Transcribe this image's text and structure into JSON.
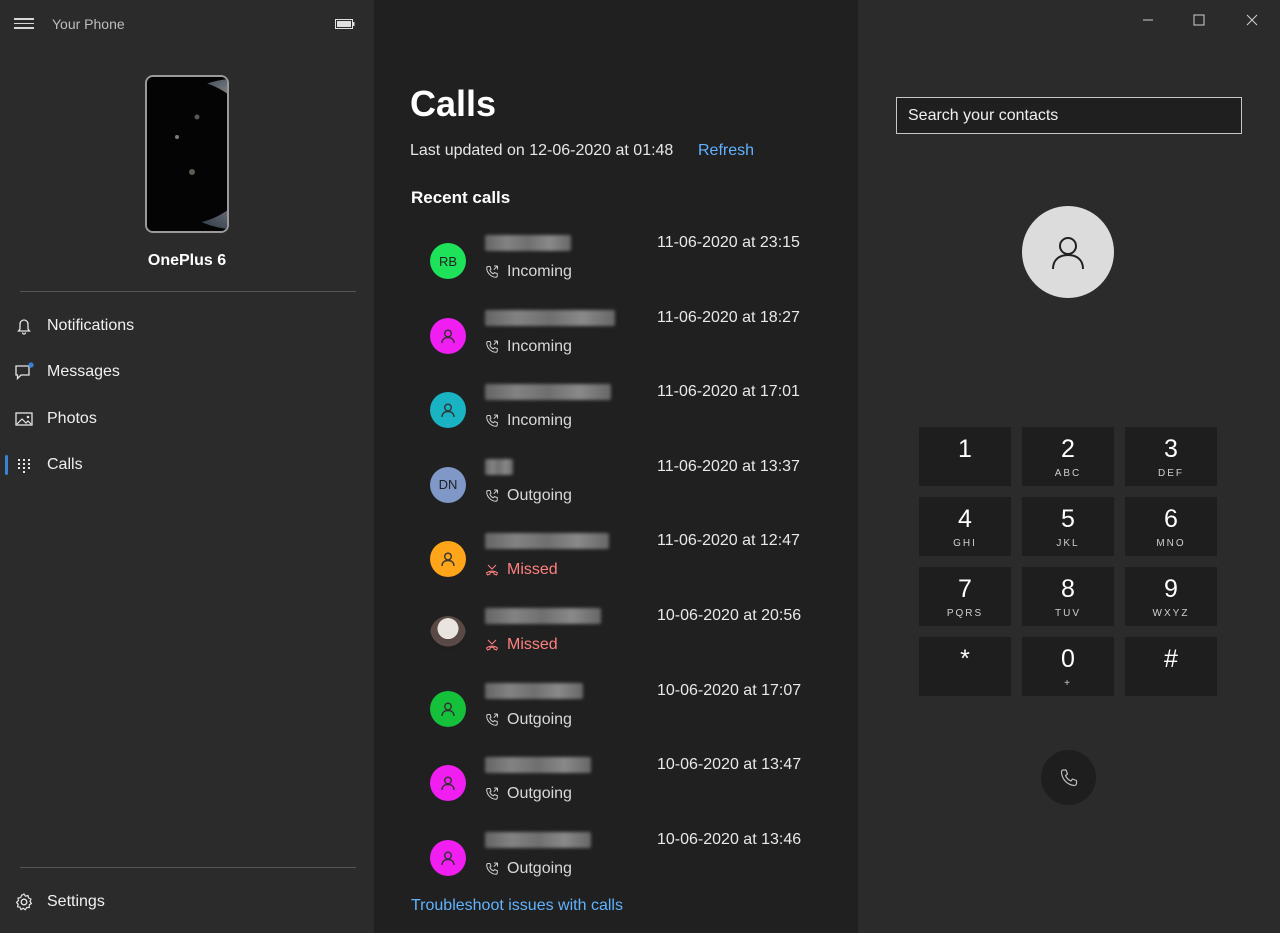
{
  "app": {
    "title": "Your Phone"
  },
  "phone": {
    "name": "OnePlus 6"
  },
  "sidebar": {
    "items": [
      {
        "label": "Notifications",
        "icon": "bell-icon"
      },
      {
        "label": "Messages",
        "icon": "message-icon"
      },
      {
        "label": "Photos",
        "icon": "photos-icon"
      },
      {
        "label": "Calls",
        "icon": "dialpad-icon",
        "active": true
      }
    ],
    "settings_label": "Settings"
  },
  "calls": {
    "title": "Calls",
    "last_updated": "Last updated on 12-06-2020 at 01:48",
    "refresh_label": "Refresh",
    "recent_title": "Recent calls",
    "troubleshoot_label": "Troubleshoot issues with calls",
    "items": [
      {
        "initials": "RB",
        "avatar_color": "#1ee35a",
        "time": "11-06-2020 at 23:15",
        "type": "Incoming"
      },
      {
        "initials": "",
        "avatar_color": "#f01ef0",
        "time": "11-06-2020 at 18:27",
        "type": "Incoming"
      },
      {
        "initials": "",
        "avatar_color": "#1ab3c4",
        "time": "11-06-2020 at 17:01",
        "type": "Incoming"
      },
      {
        "initials": "DN",
        "avatar_color": "#7f98c8",
        "time": "11-06-2020 at 13:37",
        "type": "Outgoing"
      },
      {
        "initials": "",
        "avatar_color": "#ffa51a",
        "time": "11-06-2020 at 12:47",
        "type": "Missed"
      },
      {
        "initials": "",
        "avatar_color": "photo",
        "time": "10-06-2020 at 20:56",
        "type": "Missed"
      },
      {
        "initials": "",
        "avatar_color": "#15c03a",
        "time": "10-06-2020 at 17:07",
        "type": "Outgoing"
      },
      {
        "initials": "",
        "avatar_color": "#f01ef0",
        "time": "10-06-2020 at 13:47",
        "type": "Outgoing"
      },
      {
        "initials": "",
        "avatar_color": "#f01ef0",
        "time": "10-06-2020 at 13:46",
        "type": "Outgoing"
      }
    ]
  },
  "dialer": {
    "search_placeholder": "Search your contacts",
    "keys": [
      {
        "digit": "1",
        "letters": ""
      },
      {
        "digit": "2",
        "letters": "ABC"
      },
      {
        "digit": "3",
        "letters": "DEF"
      },
      {
        "digit": "4",
        "letters": "GHI"
      },
      {
        "digit": "5",
        "letters": "JKL"
      },
      {
        "digit": "6",
        "letters": "MNO"
      },
      {
        "digit": "7",
        "letters": "PQRS"
      },
      {
        "digit": "8",
        "letters": "TUV"
      },
      {
        "digit": "9",
        "letters": "WXYZ"
      },
      {
        "digit": "*",
        "letters": ""
      },
      {
        "digit": "0",
        "letters": "+"
      },
      {
        "digit": "#",
        "letters": ""
      }
    ]
  },
  "colors": {
    "accent": "#60b3ff",
    "missed": "#ff8080",
    "selection": "#3b82d6"
  }
}
